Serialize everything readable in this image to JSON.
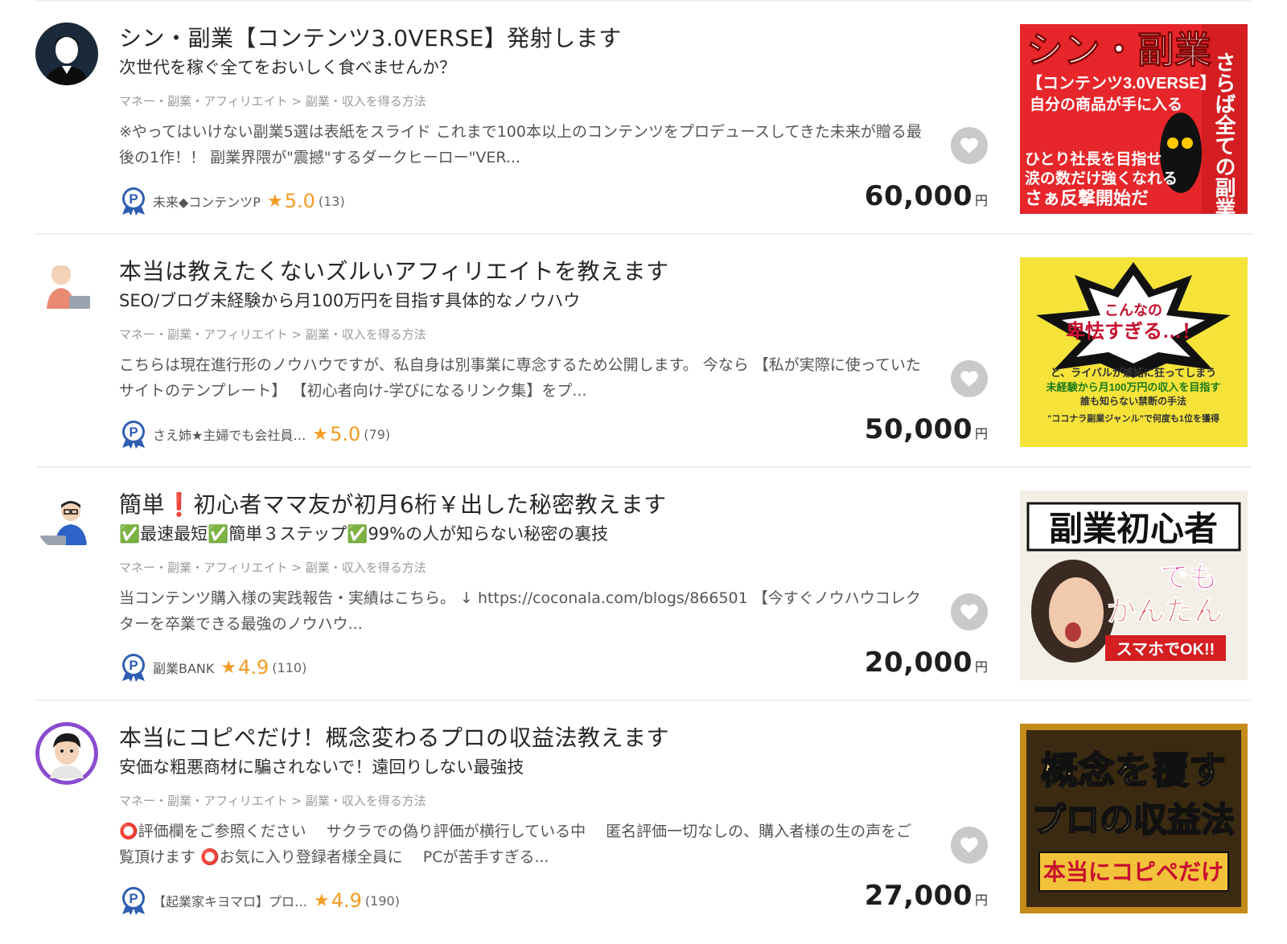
{
  "listings": [
    {
      "title": "シン・副業【コンテンツ3.0VERSE】発射します",
      "subtitle": "次世代を稼ぐ全てをおいしく食べませんか？",
      "category": "マネー・副業・アフィリエイト > 副業・収入を得る方法",
      "description": "※やってはいけない副業5選は表紙をスライド これまで100本以上のコンテンツをプロデュースしてきた未来が贈る最後の1作！！ 副業界隈が\"震撼\"するダークヒーロー\"VER...",
      "seller": "未来◆コンテンツP",
      "rating": "5.0",
      "reviews": "(13)",
      "price": "60,000",
      "currency": "円",
      "thumb": {
        "bg": "#e6262a",
        "line1": "シン・副業",
        "line2": "【コンテンツ3.0VERSE】",
        "line3": "自分の商品が手に入る",
        "line4": "ひとり社長を目指せ",
        "line5": "涙の数だけ強くなれる",
        "line6": "さぁ反撃開始だ",
        "vertical": "さらば全ての副業"
      }
    },
    {
      "title": "本当は教えたくないズルいアフィリエイトを教えます",
      "subtitle": "SEO/ブログ未経験から月100万円を目指す具体的なノウハウ",
      "category": "マネー・副業・アフィリエイト > 副業・収入を得る方法",
      "description": "こちらは現在進行形のノウハウですが、私自身は別事業に専念するため公開します。 今なら 【私が実際に使っていたサイトのテンプレート】 【初心者向け-学びになるリンク集】をプ...",
      "seller": "さえ姉★主婦でも会社員…",
      "rating": "5.0",
      "reviews": "(79)",
      "price": "50,000",
      "currency": "円",
      "thumb": {
        "bg": "#f5e33a",
        "line1": "こんなの",
        "line2": "卑怯すぎる…！",
        "line3": "と、ライバルが嫉妬に狂ってしまう",
        "line4": "未経験から月100万円の収入を目指す",
        "line5": "誰も知らない禁断の手法",
        "line6": "\"ココナラ副業ジャンル\"で何度も1位を獲得"
      }
    },
    {
      "title": "簡単❗️初心者ママ友が初月6桁￥出した秘密教えます",
      "subtitle": "✅最速最短✅簡単３ステップ✅99%の人が知らない秘密の裏技",
      "category": "マネー・副業・アフィリエイト > 副業・収入を得る方法",
      "description": "当コンテンツ購入様の実践報告・実績はこちら。 ↓ https://coconala.com/blogs/866501 【今すぐノウハウコレクターを卒業できる最強のノウハウ...",
      "seller": "副業BANK",
      "rating": "4.9",
      "reviews": "(110)",
      "price": "20,000",
      "currency": "円",
      "thumb": {
        "bg": "#f4efe6",
        "line1": "副業初心者",
        "line2": "でも",
        "line3": "かんたん",
        "line4": "スマホでOK!!"
      }
    },
    {
      "title": "本当にコピペだけ！概念変わるプロの収益法教えます",
      "subtitle": "安価な粗悪商材に騙されないで！遠回りしない最強技",
      "category": "マネー・副業・アフィリエイト > 副業・収入を得る方法",
      "description_prefix": "⭕",
      "description": "評価欄をご参照ください　 サクラでの偽り評価が横行している中　 匿名評価一切なしの、購入者様の生の声をご覧頂けます ⭕お気に入り登録者様全員に　 PCが苦手すぎる...",
      "seller": "【起業家キヨマロ】プロ…",
      "rating": "4.9",
      "reviews": "(190)",
      "price": "27,000",
      "currency": "円",
      "thumb": {
        "bg": "#3a2a12",
        "line1": "概念を覆す",
        "line2": "プロの収益法",
        "line3": "本当にコピペだけ"
      }
    }
  ],
  "icons": {
    "favorite": "heart-icon",
    "pro_badge": "pro-badge-icon",
    "star": "star-icon"
  },
  "colors": {
    "rating": "#f59b23",
    "favorite_bg": "#c9c9c9",
    "divider": "#eef0f2",
    "pro_badge": "#2f5fb3"
  }
}
